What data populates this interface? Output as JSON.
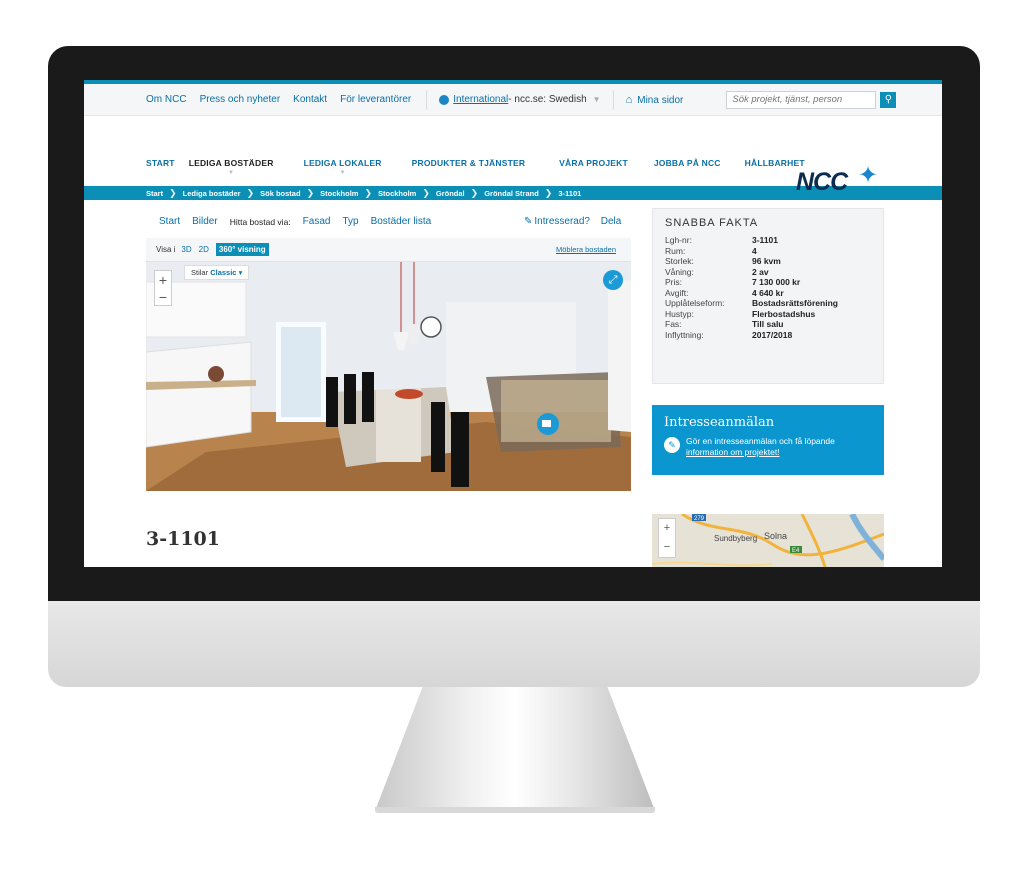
{
  "utility_bar": {
    "links": [
      "Om NCC",
      "Press och nyheter",
      "Kontakt",
      "För leverantörer"
    ],
    "international_link": "International",
    "site_label": " - ncc.se: Swedish",
    "my_pages": "Mina sidor",
    "search_placeholder": "Sök projekt, tjänst, person"
  },
  "main_nav": {
    "items": [
      "START",
      "LEDIGA BOSTÄDER",
      "LEDIGA LOKALER",
      "PRODUKTER & TJÄNSTER",
      "VÅRA PROJEKT",
      "JOBBA PÅ NCC",
      "HÅLLBARHET"
    ],
    "logo": "NCC"
  },
  "breadcrumb": [
    "Start",
    "Lediga bostäder",
    "Sök bostad",
    "Stockholm",
    "Stockholm",
    "Gröndal",
    "Gröndal Strand",
    "3-1101"
  ],
  "subnav": {
    "start": "Start",
    "bilder": "Bilder",
    "hitta_label": "Hitta bostad via:",
    "fasad": "Fasad",
    "typ": "Typ",
    "lista": "Bostäder lista",
    "interested": "Intresserad?",
    "share": "Dela"
  },
  "viewer": {
    "visa_label": "Visa i",
    "tab_3d": "3D",
    "tab_2d": "2D",
    "tab_360": "360° visning",
    "furnish_link": "Möblera bostaden",
    "style_label": "Stilar",
    "style_value": "Classic",
    "zoom_in": "+",
    "zoom_out": "−"
  },
  "quick_facts": {
    "title": "SNABBA FAKTA",
    "rows": [
      {
        "k": "Lgh-nr:",
        "v": "3-1101"
      },
      {
        "k": "Rum:",
        "v": "4"
      },
      {
        "k": "Storlek:",
        "v": "96 kvm"
      },
      {
        "k": "Våning:",
        "v": "2 av"
      },
      {
        "k": "Pris:",
        "v": "7 130 000 kr"
      },
      {
        "k": "Avgift:",
        "v": "4 640 kr"
      },
      {
        "k": "Upplåtelseform:",
        "v": "Bostadsrättsförening"
      },
      {
        "k": "Hustyp:",
        "v": "Flerbostadshus"
      },
      {
        "k": "Fas:",
        "v": "Till salu"
      },
      {
        "k": "Inflyttning:",
        "v": "2017/2018"
      }
    ]
  },
  "interest": {
    "title": "Intresseanmälan",
    "text": "Gör en intresseanmälan och få löpande",
    "link": "information om projektet!"
  },
  "map": {
    "label_sundbyberg": "Sundbyberg",
    "label_solna": "Solna",
    "road_279": "279",
    "road_e4": "E4",
    "zoom_in": "+",
    "zoom_out": "−"
  },
  "apartment_heading": "3-1101",
  "colors": {
    "brand_blue": "#0b8fb6",
    "interest_blue": "#0b96cf",
    "logo_navy": "#0d2c4f"
  }
}
